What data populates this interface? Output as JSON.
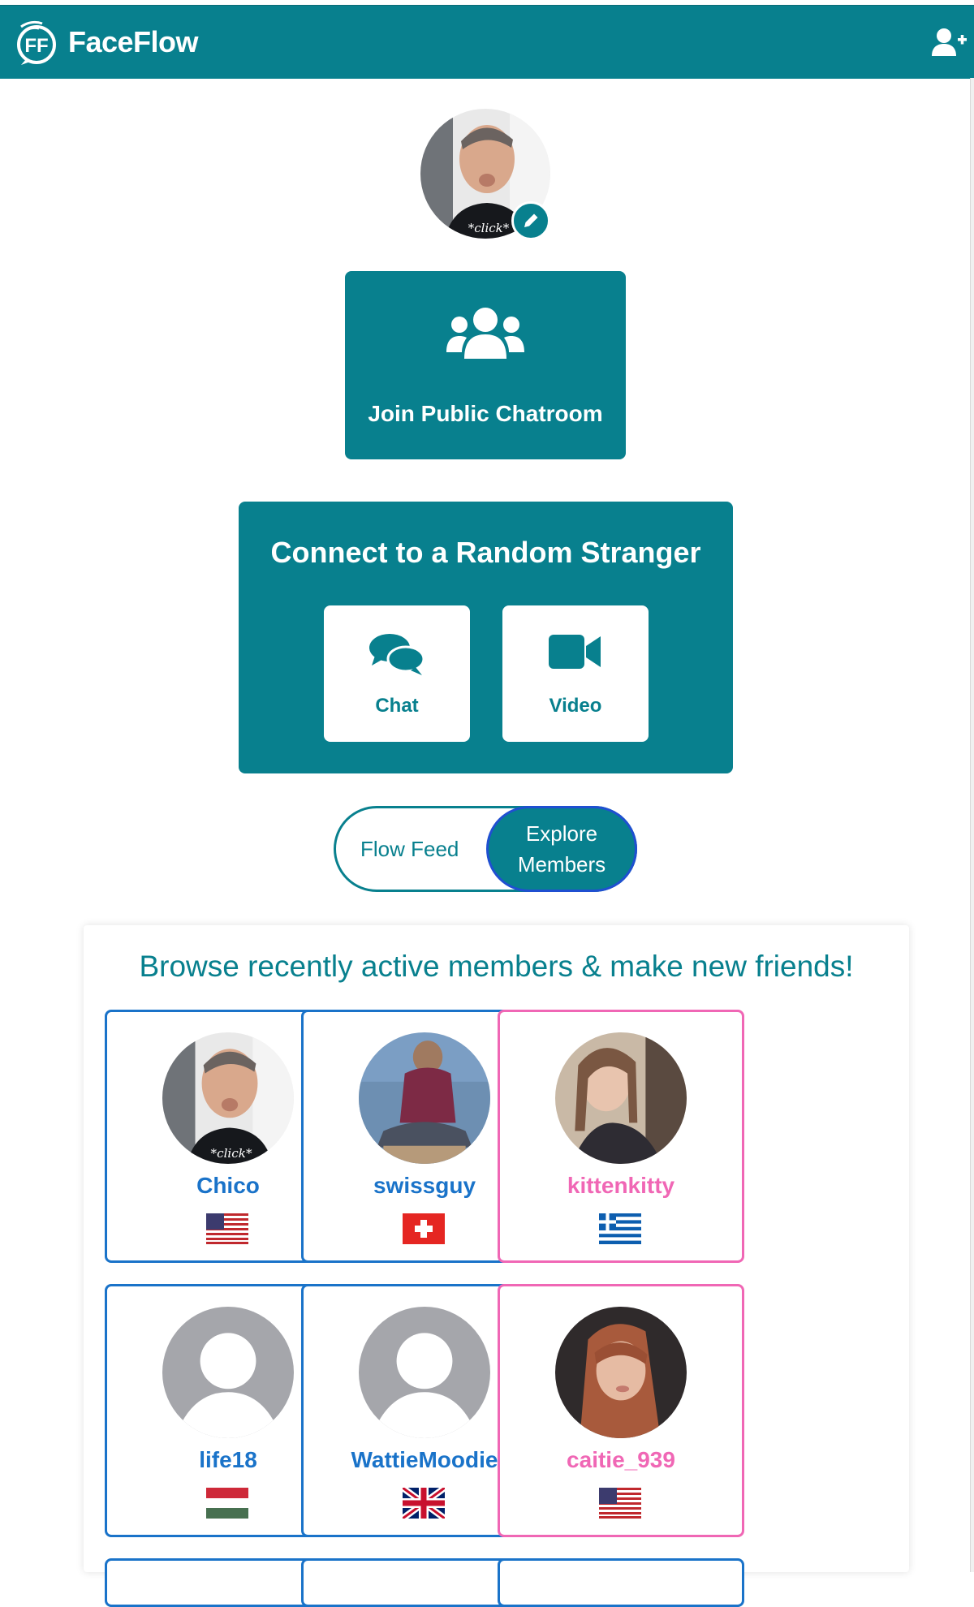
{
  "header": {
    "logo_text": "FaceFlow",
    "logo_mark": "FF",
    "add_user_icon": "user-plus-icon",
    "bar_color": "#08808e"
  },
  "profile": {
    "avatar_caption": "*click*",
    "edit_icon": "pencil-icon"
  },
  "join": {
    "label": "Join Public Chatroom",
    "icon": "users-group-icon"
  },
  "stranger": {
    "title": "Connect to a Random Stranger",
    "chat_label": "Chat",
    "chat_icon": "chat-bubbles-icon",
    "video_label": "Video",
    "video_icon": "video-camera-icon"
  },
  "toggle": {
    "feed_label": "Flow Feed",
    "explore_label": "Explore Members",
    "active": "Explore Members"
  },
  "browse": {
    "heading": "Browse recently active members & make new friends!",
    "members": [
      {
        "name": "Chico",
        "flag": "us-flag-icon",
        "gender_color": "#1a73c9",
        "photo": "avatar-photo",
        "caption": "*click*"
      },
      {
        "name": "swissguy",
        "flag": "swiss-flag-icon",
        "gender_color": "#1a73c9",
        "photo": "avatar-photo"
      },
      {
        "name": "kittenkitty",
        "flag": "greek-flag-icon",
        "gender_color": "#f067b5",
        "photo": "avatar-photo"
      },
      {
        "name": "life18",
        "flag": "hungary-flag-icon",
        "gender_color": "#1a73c9",
        "photo": "default-avatar-icon"
      },
      {
        "name": "WattieMoodie",
        "flag": "uk-flag-icon",
        "gender_color": "#1a73c9",
        "photo": "default-avatar-icon"
      },
      {
        "name": "caitie_939",
        "flag": "us-flag-icon",
        "gender_color": "#f067b5",
        "photo": "avatar-photo"
      }
    ]
  }
}
